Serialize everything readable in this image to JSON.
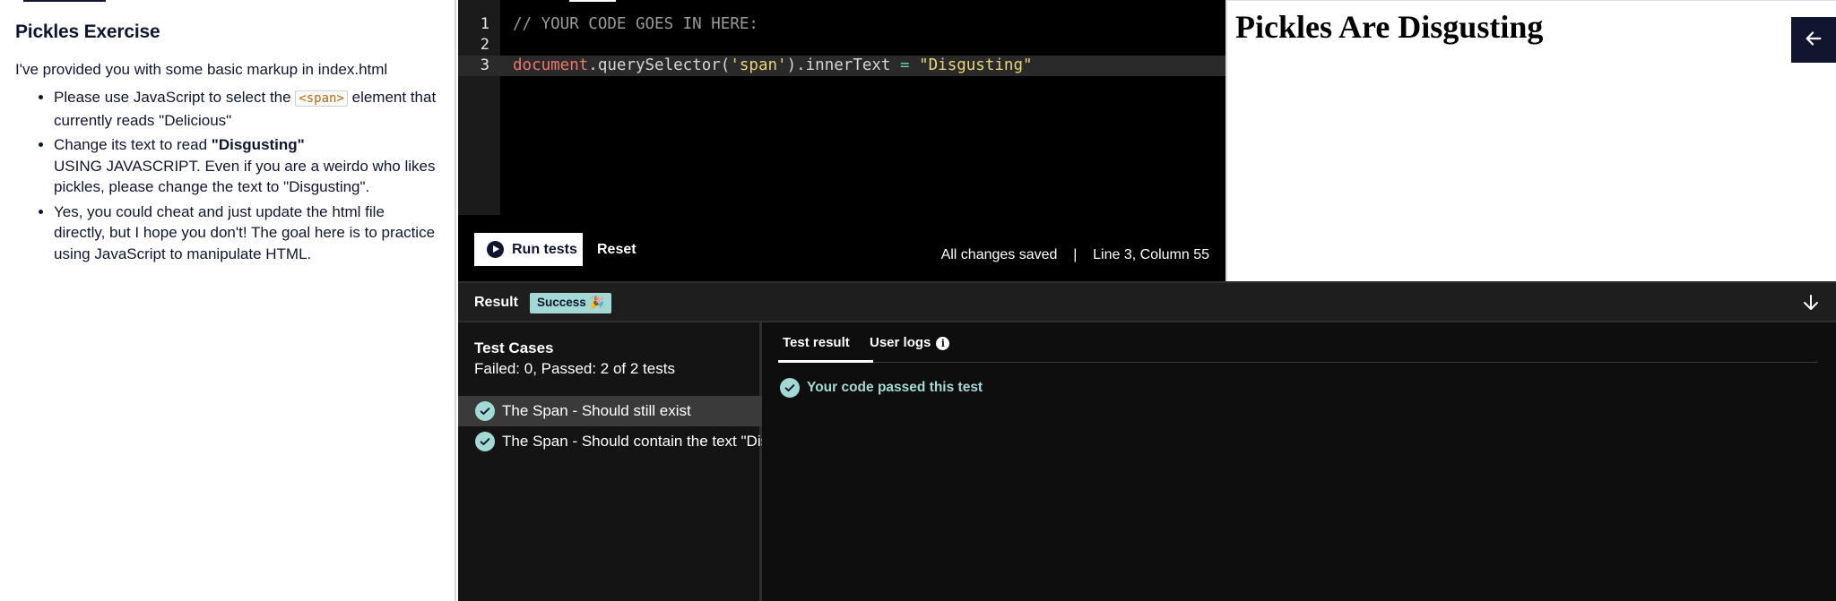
{
  "instructions": {
    "title": "Pickles Exercise",
    "intro": "I've provided you with some basic markup in index.html",
    "bullets": [
      {
        "pre": "Please use JavaScript to select the ",
        "code": "<span>",
        "post": " element that currently reads \"Delicious\""
      },
      {
        "bold": "\"Disgusting\"",
        "pre": "Change its text to read ",
        "post": "USING JAVASCRIPT. Even if you are a weirdo who likes pickles, please change the text to \"Disgusting\"."
      },
      {
        "text": "Yes, you could cheat and just update the html file directly, but I hope you don't!  The goal here is to practice using JavaScript to manipulate HTML."
      }
    ]
  },
  "editor": {
    "line_numbers": [
      "1",
      "2",
      "3"
    ],
    "lines": {
      "l1": "// YOUR CODE GOES IN HERE:",
      "l3_doc": "document",
      "l3_mid": ".querySelector(",
      "l3_str1": "'span'",
      "l3_prop": ").innerText ",
      "l3_op": "=",
      "l3_str2": " \"Disgusting\""
    },
    "run_label": "Run tests",
    "reset_label": "Reset",
    "save_status": "All changes saved",
    "separator": "|",
    "cursor_pos": "Line 3, Column 55"
  },
  "preview": {
    "heading": "Pickles Are Disgusting"
  },
  "result_bar": {
    "label": "Result",
    "badge": "Success 🎉"
  },
  "test_cases": {
    "title": "Test Cases",
    "summary": "Failed: 0, Passed: 2 of 2 tests",
    "items": [
      {
        "label": "The Span - Should still exist"
      },
      {
        "label": "The Span - Should contain the text \"Disgusting\""
      }
    ]
  },
  "test_result": {
    "tabs": [
      "Test result",
      "User logs"
    ],
    "message": "Your code passed this test"
  },
  "colors": {
    "accent_mint": "#a2d9d5",
    "navy": "#10162f"
  }
}
